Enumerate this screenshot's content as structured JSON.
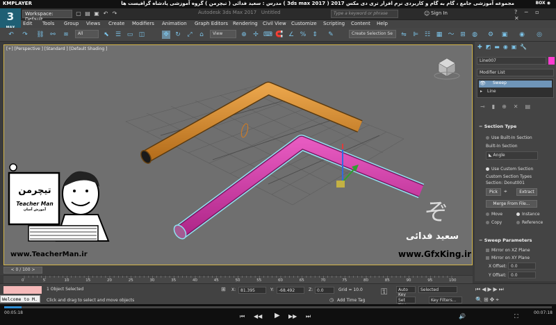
{
  "player": {
    "brand": "KMPLAYER",
    "title": "مجموعه آموزشی جامع ، گام به گام و کاربردی نرم افزار تری دی مکس 2017 ( 3ds max 2017 )   مدرس : سعید فدائی ( تیچرمن ) گروه آموزشی پادشاه گرافیست ها",
    "box_label": "BOX ◉",
    "time_left": "00:05:18",
    "time_right": "00:07:18",
    "tooltip": "Welcome to M."
  },
  "app": {
    "logo_text": "3",
    "logo_sub": "MAX",
    "workspace": "Workspace: Default",
    "title": "Autodesk 3ds Max 2017",
    "untitled": "Untitled",
    "search_placeholder": "Type a keyword or phrase",
    "signin": "Sign In"
  },
  "menu": [
    "Edit",
    "Tools",
    "Group",
    "Views",
    "Create",
    "Modifiers",
    "Animation",
    "Graph Editors",
    "Rendering",
    "Civil View",
    "Customize",
    "Scripting",
    "Content",
    "Help"
  ],
  "toolbar": {
    "filter": "All",
    "refcoord": "View",
    "selection_set": "Create Selection Se"
  },
  "viewport": {
    "label": "[+] [Perspective ] [Standard ] [Default Shading ]",
    "watermark_url": "www.GfxKing.ir",
    "watermark_name": "سعید فدائی",
    "teacher_site": "www.TeacherMan.ir",
    "teacher_logo": "تیچرمن",
    "teacher_en": "Teacher Man",
    "teacher_sub": "آموزش آسان"
  },
  "panel": {
    "object_name": "Line007",
    "modifier_list": "Modifier List",
    "stack": [
      "Sweep",
      "Line"
    ],
    "section_type": "Section Type",
    "use_builtin": "Use Built-In Section",
    "builtin_section": "Built-In Section",
    "angle": "Angle",
    "use_custom": "Use Custom Section",
    "custom_types": "Custom Section Types",
    "section_value": "Section: Donut001",
    "pick": "Pick",
    "extract": "Extract",
    "merge": "Merge From File...",
    "move": "Move",
    "instance": "Instance",
    "copy": "Copy",
    "reference": "Reference",
    "sweep_params": "Sweep Parameters",
    "mirror_xz": "Mirror on XZ Plane",
    "mirror_xy": "Mirror on XY Plane",
    "x_offset_label": "X Offset:",
    "x_offset": "0.0",
    "y_offset_label": "Y Offset:",
    "y_offset": "0.0"
  },
  "timeline": {
    "frame": "0 / 100",
    "ticks": [
      "0",
      "5",
      "10",
      "15",
      "20",
      "25",
      "30",
      "35",
      "40",
      "45",
      "50",
      "55",
      "60",
      "65",
      "70",
      "75",
      "80",
      "85",
      "90",
      "95",
      "100"
    ]
  },
  "status": {
    "selected": "1 Object Selected",
    "prompt": "Click and drag to select and move objects",
    "x_label": "X:",
    "x": "81.395",
    "y_label": "Y:",
    "y": "-68.492",
    "z_label": "Z:",
    "z": "0.0",
    "grid": "Grid = 10.0",
    "add_tag": "Add Time Tag",
    "autokey": "Auto Key",
    "selected_dd": "Selected",
    "setkey": "Set Key",
    "keyfilters": "Key Filters..."
  },
  "colors": {
    "orange_tube": "#d2892d",
    "magenta_tube": "#d63bab",
    "selection_outline": "#8fe3f0",
    "accent": "#7cc3e8"
  }
}
